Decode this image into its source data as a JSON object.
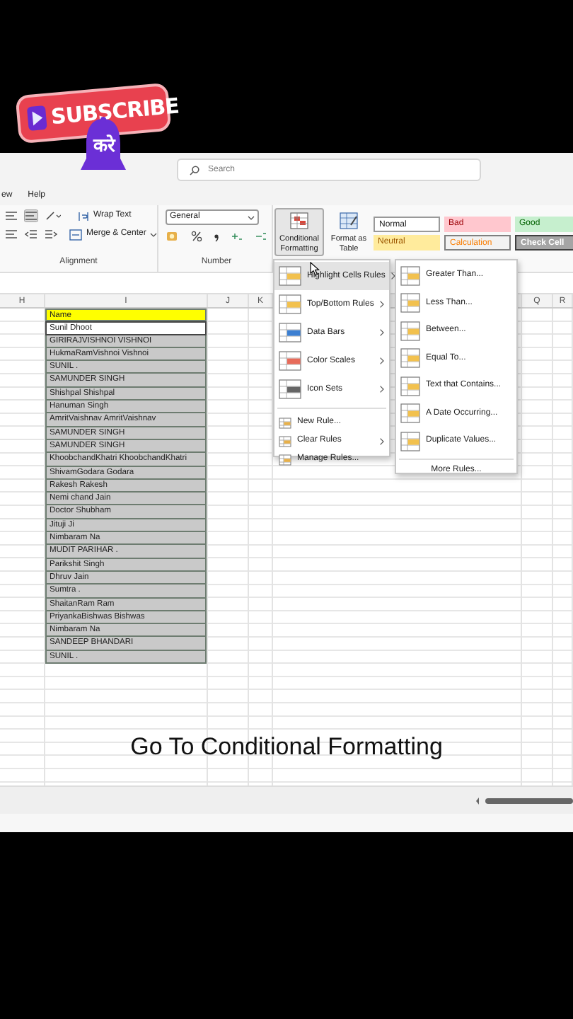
{
  "overlay": {
    "sticker_text": "SUBSCRIBE",
    "bell_text": "करे"
  },
  "title_bar": {
    "search": {
      "placeholder": "Search"
    }
  },
  "tabs": [
    {
      "label": "ew",
      "selected": false
    },
    {
      "label": "Help",
      "selected": false
    }
  ],
  "ribbon": {
    "alignment": {
      "label": "Alignment",
      "wrap_text": "Wrap Text",
      "merge": "Merge & Center"
    },
    "number": {
      "label": "Number",
      "format": "General"
    },
    "conditional_formatting": {
      "label": "Conditional Formatting",
      "selected": true
    },
    "format_as_table": "Format as Table",
    "cell_styles": [
      {
        "label": "Normal",
        "kind": "normal"
      },
      {
        "label": "Bad",
        "kind": "bad"
      },
      {
        "label": "Good",
        "kind": "good"
      },
      {
        "label": "Neutral",
        "kind": "neutral"
      },
      {
        "label": "Calculation",
        "kind": "calculation"
      },
      {
        "label": "Check Cell",
        "kind": "check"
      }
    ]
  },
  "columns": [
    "H",
    "I",
    "J",
    "K",
    "Q",
    "R"
  ],
  "rows": [
    {
      "text": "Name",
      "kind": "header"
    },
    {
      "text": "Sunil Dhoot",
      "kind": "active"
    },
    {
      "text": "GIRIRAJVISHNOI VISHNOI",
      "kind": "range"
    },
    {
      "text": "HukmaRamVishnoi Vishnoi",
      "kind": "range"
    },
    {
      "text": "SUNIL .",
      "kind": "range"
    },
    {
      "text": "SAMUNDER SINGH",
      "kind": "range"
    },
    {
      "text": "Shishpal Shishpal",
      "kind": "range"
    },
    {
      "text": "Hanuman Singh",
      "kind": "range"
    },
    {
      "text": "AmritVaishnav AmritVaishnav",
      "kind": "range"
    },
    {
      "text": "SAMUNDER SINGH",
      "kind": "range"
    },
    {
      "text": "SAMUNDER SINGH",
      "kind": "range"
    },
    {
      "text": "KhoobchandKhatri KhoobchandKhatri",
      "kind": "range"
    },
    {
      "text": "ShivamGodara Godara",
      "kind": "range"
    },
    {
      "text": "Rakesh Rakesh",
      "kind": "range"
    },
    {
      "text": "Nemi chand Jain",
      "kind": "range"
    },
    {
      "text": "Doctor Shubham",
      "kind": "range"
    },
    {
      "text": "Jituji Ji",
      "kind": "range"
    },
    {
      "text": "Nimbaram Na",
      "kind": "range"
    },
    {
      "text": "MUDIT PARIHAR .",
      "kind": "range"
    },
    {
      "text": "Parikshit Singh",
      "kind": "range"
    },
    {
      "text": "Dhruv Jain",
      "kind": "range"
    },
    {
      "text": "Sumtra .",
      "kind": "range"
    },
    {
      "text": "ShaitanRam Ram",
      "kind": "range"
    },
    {
      "text": "PriyankaBishwas Bishwas",
      "kind": "range"
    },
    {
      "text": "Nimbaram Na",
      "kind": "range"
    },
    {
      "text": "SANDEEP BHANDARI",
      "kind": "range"
    },
    {
      "text": "SUNIL .",
      "kind": "range"
    }
  ],
  "menu": {
    "items": [
      {
        "label": "Highlight Cells Rules",
        "kind": "rule",
        "selected": true,
        "submenu": true
      },
      {
        "label": "Top/Bottom Rules",
        "kind": "rule",
        "selected": false,
        "submenu": true
      },
      {
        "label": "Data Bars",
        "kind": "rule",
        "selected": false,
        "submenu": true
      },
      {
        "label": "Color Scales",
        "kind": "rule",
        "selected": false,
        "submenu": true
      },
      {
        "label": "Icon Sets",
        "kind": "rule",
        "selected": false,
        "submenu": true
      },
      {
        "label": "New Rule...",
        "kind": "command",
        "selected": false,
        "submenu": false
      },
      {
        "label": "Clear Rules",
        "kind": "command",
        "selected": false,
        "submenu": true
      },
      {
        "label": "Manage Rules...",
        "kind": "command",
        "selected": false,
        "submenu": false
      }
    ]
  },
  "submenu": {
    "items": [
      "Greater Than...",
      "Less Than...",
      "Between...",
      "Equal To...",
      "Text that Contains...",
      "A Date Occurring...",
      "Duplicate Values..."
    ],
    "footer": "More Rules..."
  },
  "caption": "Go To Conditional Formatting"
}
